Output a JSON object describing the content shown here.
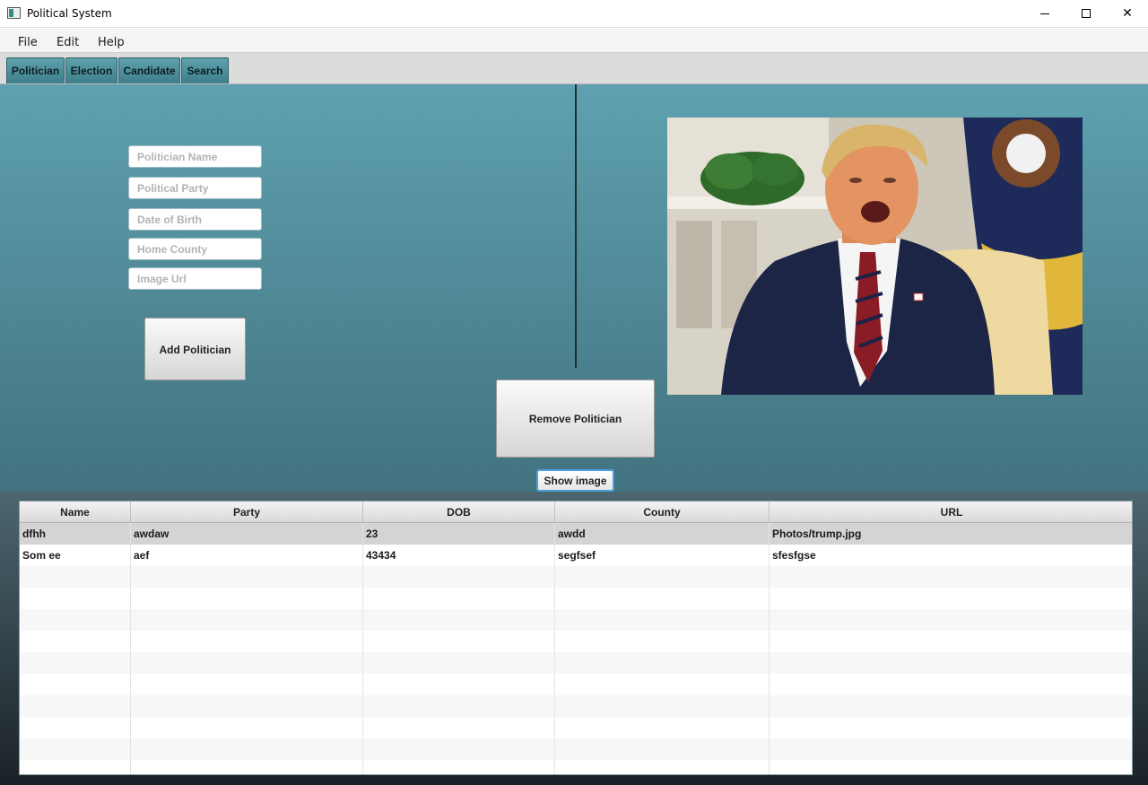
{
  "window": {
    "title": "Political System",
    "icon": "app-window-icon"
  },
  "menu": {
    "items": [
      "File",
      "Edit",
      "Help"
    ]
  },
  "tabs": [
    "Politician",
    "Election",
    "Candidate",
    "Search"
  ],
  "form": {
    "name_placeholder": "Politician Name",
    "party_placeholder": "Political Party",
    "dob_placeholder": "Date of Birth",
    "county_placeholder": "Home County",
    "url_placeholder": "Image Url",
    "add_label": "Add Politician",
    "remove_label": "Remove Politician",
    "show_label": "Show image"
  },
  "photo": {
    "subject": "portrait-photo"
  },
  "table": {
    "columns": [
      "Name",
      "Party",
      "DOB",
      "County",
      "URL"
    ],
    "rows": [
      [
        "dfhh",
        "awdaw",
        "23",
        "awdd",
        "Photos/trump.jpg"
      ],
      [
        "Som ee",
        "aef",
        "43434",
        "segfsef",
        "sfesfgse"
      ]
    ]
  }
}
